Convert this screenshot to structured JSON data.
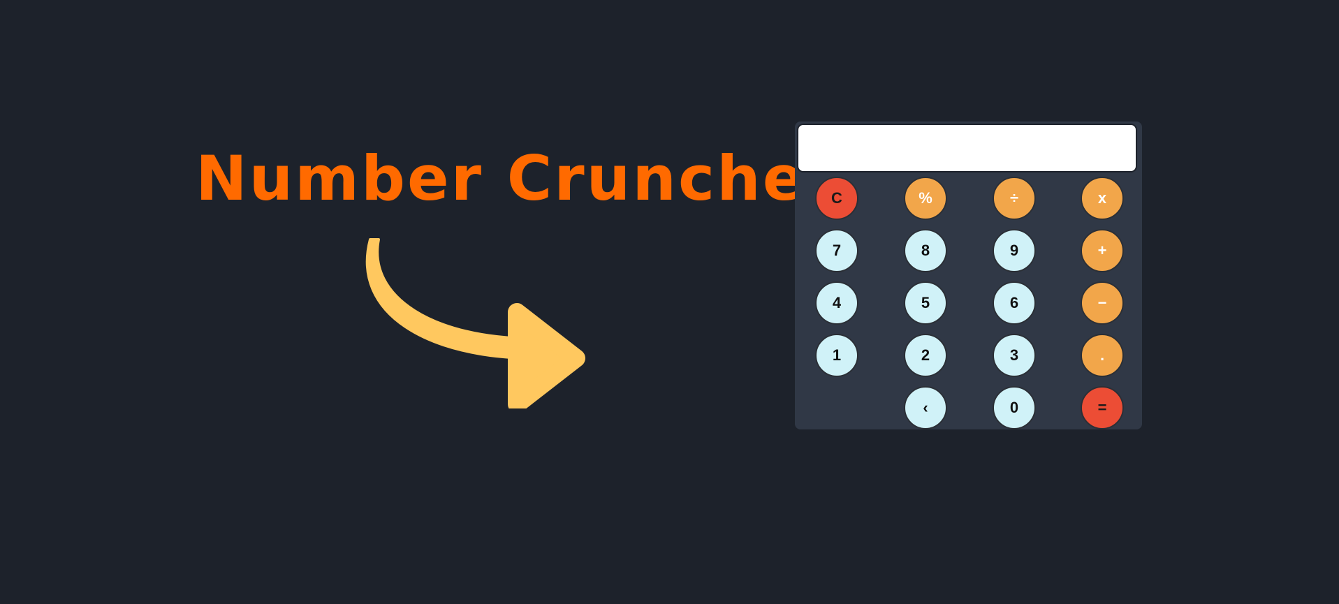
{
  "app": {
    "title": "Number Cruncher"
  },
  "display": {
    "value": "",
    "placeholder": ""
  },
  "keypad": {
    "rows": [
      [
        {
          "label": "C",
          "name": "clear-button",
          "kind": "red"
        },
        {
          "label": "%",
          "name": "percent-button",
          "kind": "op"
        },
        {
          "label": "÷",
          "name": "divide-button",
          "kind": "op"
        },
        {
          "label": "x",
          "name": "multiply-button",
          "kind": "op"
        }
      ],
      [
        {
          "label": "7",
          "name": "digit-7-button",
          "kind": "num"
        },
        {
          "label": "8",
          "name": "digit-8-button",
          "kind": "num"
        },
        {
          "label": "9",
          "name": "digit-9-button",
          "kind": "num"
        },
        {
          "label": "+",
          "name": "add-button",
          "kind": "op"
        }
      ],
      [
        {
          "label": "4",
          "name": "digit-4-button",
          "kind": "num"
        },
        {
          "label": "5",
          "name": "digit-5-button",
          "kind": "num"
        },
        {
          "label": "6",
          "name": "digit-6-button",
          "kind": "num"
        },
        {
          "label": "−",
          "name": "subtract-button",
          "kind": "op"
        }
      ],
      [
        {
          "label": "1",
          "name": "digit-1-button",
          "kind": "num"
        },
        {
          "label": "2",
          "name": "digit-2-button",
          "kind": "num"
        },
        {
          "label": "3",
          "name": "digit-3-button",
          "kind": "num"
        },
        {
          "label": ".",
          "name": "decimal-button",
          "kind": "op"
        }
      ],
      [
        {
          "label": "‹",
          "name": "backspace-button",
          "kind": "num"
        },
        {
          "label": "0",
          "name": "digit-0-button",
          "kind": "num"
        },
        {
          "label": "=",
          "name": "equals-button",
          "kind": "red"
        }
      ]
    ]
  },
  "decoration": {
    "arrow_icon": "curved-arrow-right-icon",
    "arrow_color": "#ffc85f"
  },
  "colors": {
    "background": "#1d222b",
    "title": "#ff6a00",
    "calculator_body": "#303846",
    "digit_key": "#d0f2f8",
    "operator_key": "#f2a64a",
    "clear_equals_key": "#ec4d35"
  }
}
